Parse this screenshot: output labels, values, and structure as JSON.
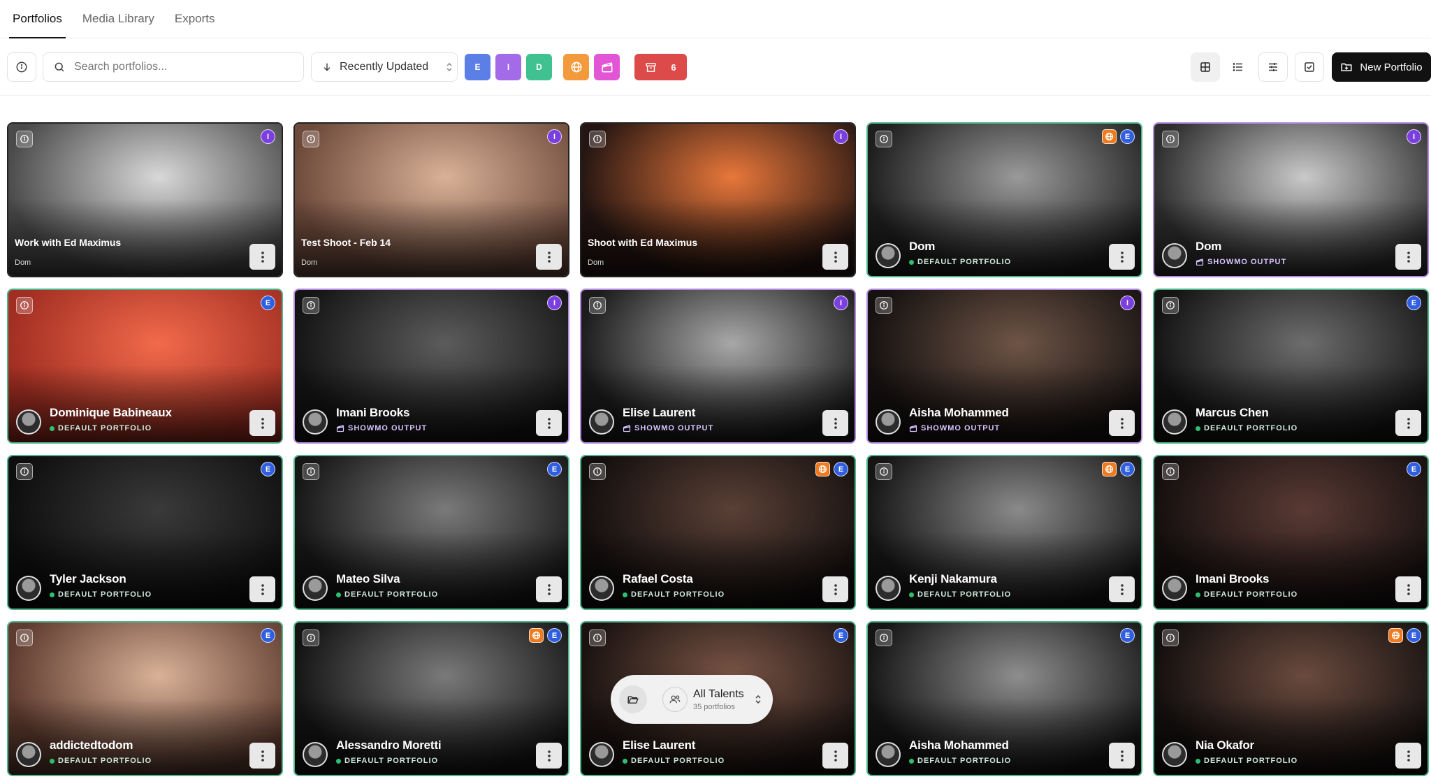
{
  "tabs": [
    {
      "label": "Portfolios",
      "active": true
    },
    {
      "label": "Media Library",
      "active": false
    },
    {
      "label": "Exports",
      "active": false
    }
  ],
  "toolbar": {
    "search_placeholder": "Search portfolios...",
    "sort_label": "Recently Updated",
    "filter_chips": [
      {
        "label": "E",
        "color": "#5b7fe6"
      },
      {
        "label": "I",
        "color": "#a46be8"
      },
      {
        "label": "D",
        "color": "#3fc28f"
      }
    ],
    "web_chip_color": "#f39a3c",
    "showmo_chip_color": "#e256d6",
    "archive_count": "6",
    "new_portfolio_label": "New Portfolio"
  },
  "cards": [
    {
      "title": "Work with Ed Maximus",
      "owner": "Dom",
      "style": "plain",
      "badges": [
        "I"
      ],
      "colors": [
        "#d8d8d8",
        "#4a4a4a"
      ]
    },
    {
      "title": "Test Shoot - Feb 14",
      "owner": "Dom",
      "style": "plain",
      "badges": [
        "I"
      ],
      "colors": [
        "#d9b197",
        "#6e4a3b"
      ]
    },
    {
      "title": "Shoot with Ed Maximus",
      "owner": "Dom",
      "style": "plain",
      "badges": [
        "I"
      ],
      "colors": [
        "#e8773a",
        "#241512"
      ]
    },
    {
      "name": "Dom",
      "type": "DEFAULT PORTFOLIO",
      "style": "green",
      "badges": [
        "web",
        "E"
      ],
      "colors": [
        "#9a9a9a",
        "#1e1e1e"
      ]
    },
    {
      "name": "Dom",
      "type": "SHOWMO OUTPUT",
      "style": "purple",
      "badges": [
        "I"
      ],
      "colors": [
        "#c9c9c9",
        "#2e2e2e"
      ]
    },
    {
      "name": "Dominique Babineaux",
      "type": "DEFAULT PORTFOLIO",
      "style": "green",
      "badges": [
        "E"
      ],
      "colors": [
        "#f26a4b",
        "#a12e22"
      ]
    },
    {
      "name": "Imani Brooks",
      "type": "SHOWMO OUTPUT",
      "style": "purple",
      "badges": [
        "I"
      ],
      "colors": [
        "#5c5c5c",
        "#141414"
      ]
    },
    {
      "name": "Elise Laurent",
      "type": "SHOWMO OUTPUT",
      "style": "purple",
      "badges": [
        "I"
      ],
      "colors": [
        "#a8a8a8",
        "#1b1b1b"
      ]
    },
    {
      "name": "Aisha Mohammed",
      "type": "SHOWMO OUTPUT",
      "style": "purple",
      "badges": [
        "I"
      ],
      "colors": [
        "#6e5446",
        "#151110"
      ]
    },
    {
      "name": "Marcus Chen",
      "type": "DEFAULT PORTFOLIO",
      "style": "green",
      "badges": [
        "E"
      ],
      "colors": [
        "#6d6d6d",
        "#131313"
      ]
    },
    {
      "name": "Tyler Jackson",
      "type": "DEFAULT PORTFOLIO",
      "style": "green",
      "badges": [
        "E"
      ],
      "colors": [
        "#3a3a3a",
        "#0e0e0e"
      ]
    },
    {
      "name": "Mateo Silva",
      "type": "DEFAULT PORTFOLIO",
      "style": "green",
      "badges": [
        "E"
      ],
      "colors": [
        "#7a7a7a",
        "#161616"
      ]
    },
    {
      "name": "Rafael Costa",
      "type": "DEFAULT PORTFOLIO",
      "style": "green",
      "badges": [
        "web",
        "E"
      ],
      "colors": [
        "#5a4036",
        "#120e0d"
      ]
    },
    {
      "name": "Kenji Nakamura",
      "type": "DEFAULT PORTFOLIO",
      "style": "green",
      "badges": [
        "web",
        "E"
      ],
      "colors": [
        "#8a8a8a",
        "#151515"
      ]
    },
    {
      "name": "Imani Brooks",
      "type": "DEFAULT PORTFOLIO",
      "style": "green",
      "badges": [
        "E"
      ],
      "colors": [
        "#5a3a34",
        "#140f0e"
      ]
    },
    {
      "name": "addictedtodom",
      "type": "DEFAULT PORTFOLIO",
      "style": "green",
      "badges": [
        "E"
      ],
      "colors": [
        "#d9b197",
        "#5e3b2f"
      ]
    },
    {
      "name": "Alessandro Moretti",
      "type": "DEFAULT PORTFOLIO",
      "style": "green",
      "badges": [
        "web",
        "E"
      ],
      "colors": [
        "#7a7a7a",
        "#141414"
      ]
    },
    {
      "name": "Elise Laurent",
      "type": "DEFAULT PORTFOLIO",
      "style": "green",
      "badges": [
        "E"
      ],
      "colors": [
        "#7a5546",
        "#1a1210"
      ]
    },
    {
      "name": "Aisha Mohammed",
      "type": "DEFAULT PORTFOLIO",
      "style": "green",
      "badges": [
        "E"
      ],
      "colors": [
        "#8e8e8e",
        "#151515"
      ]
    },
    {
      "name": "Nia Okafor",
      "type": "DEFAULT PORTFOLIO",
      "style": "green",
      "badges": [
        "web",
        "E"
      ],
      "colors": [
        "#6a4a3e",
        "#130f0e"
      ]
    }
  ],
  "talent_switcher": {
    "label": "All Talents",
    "count_text": "35 portfolios"
  }
}
